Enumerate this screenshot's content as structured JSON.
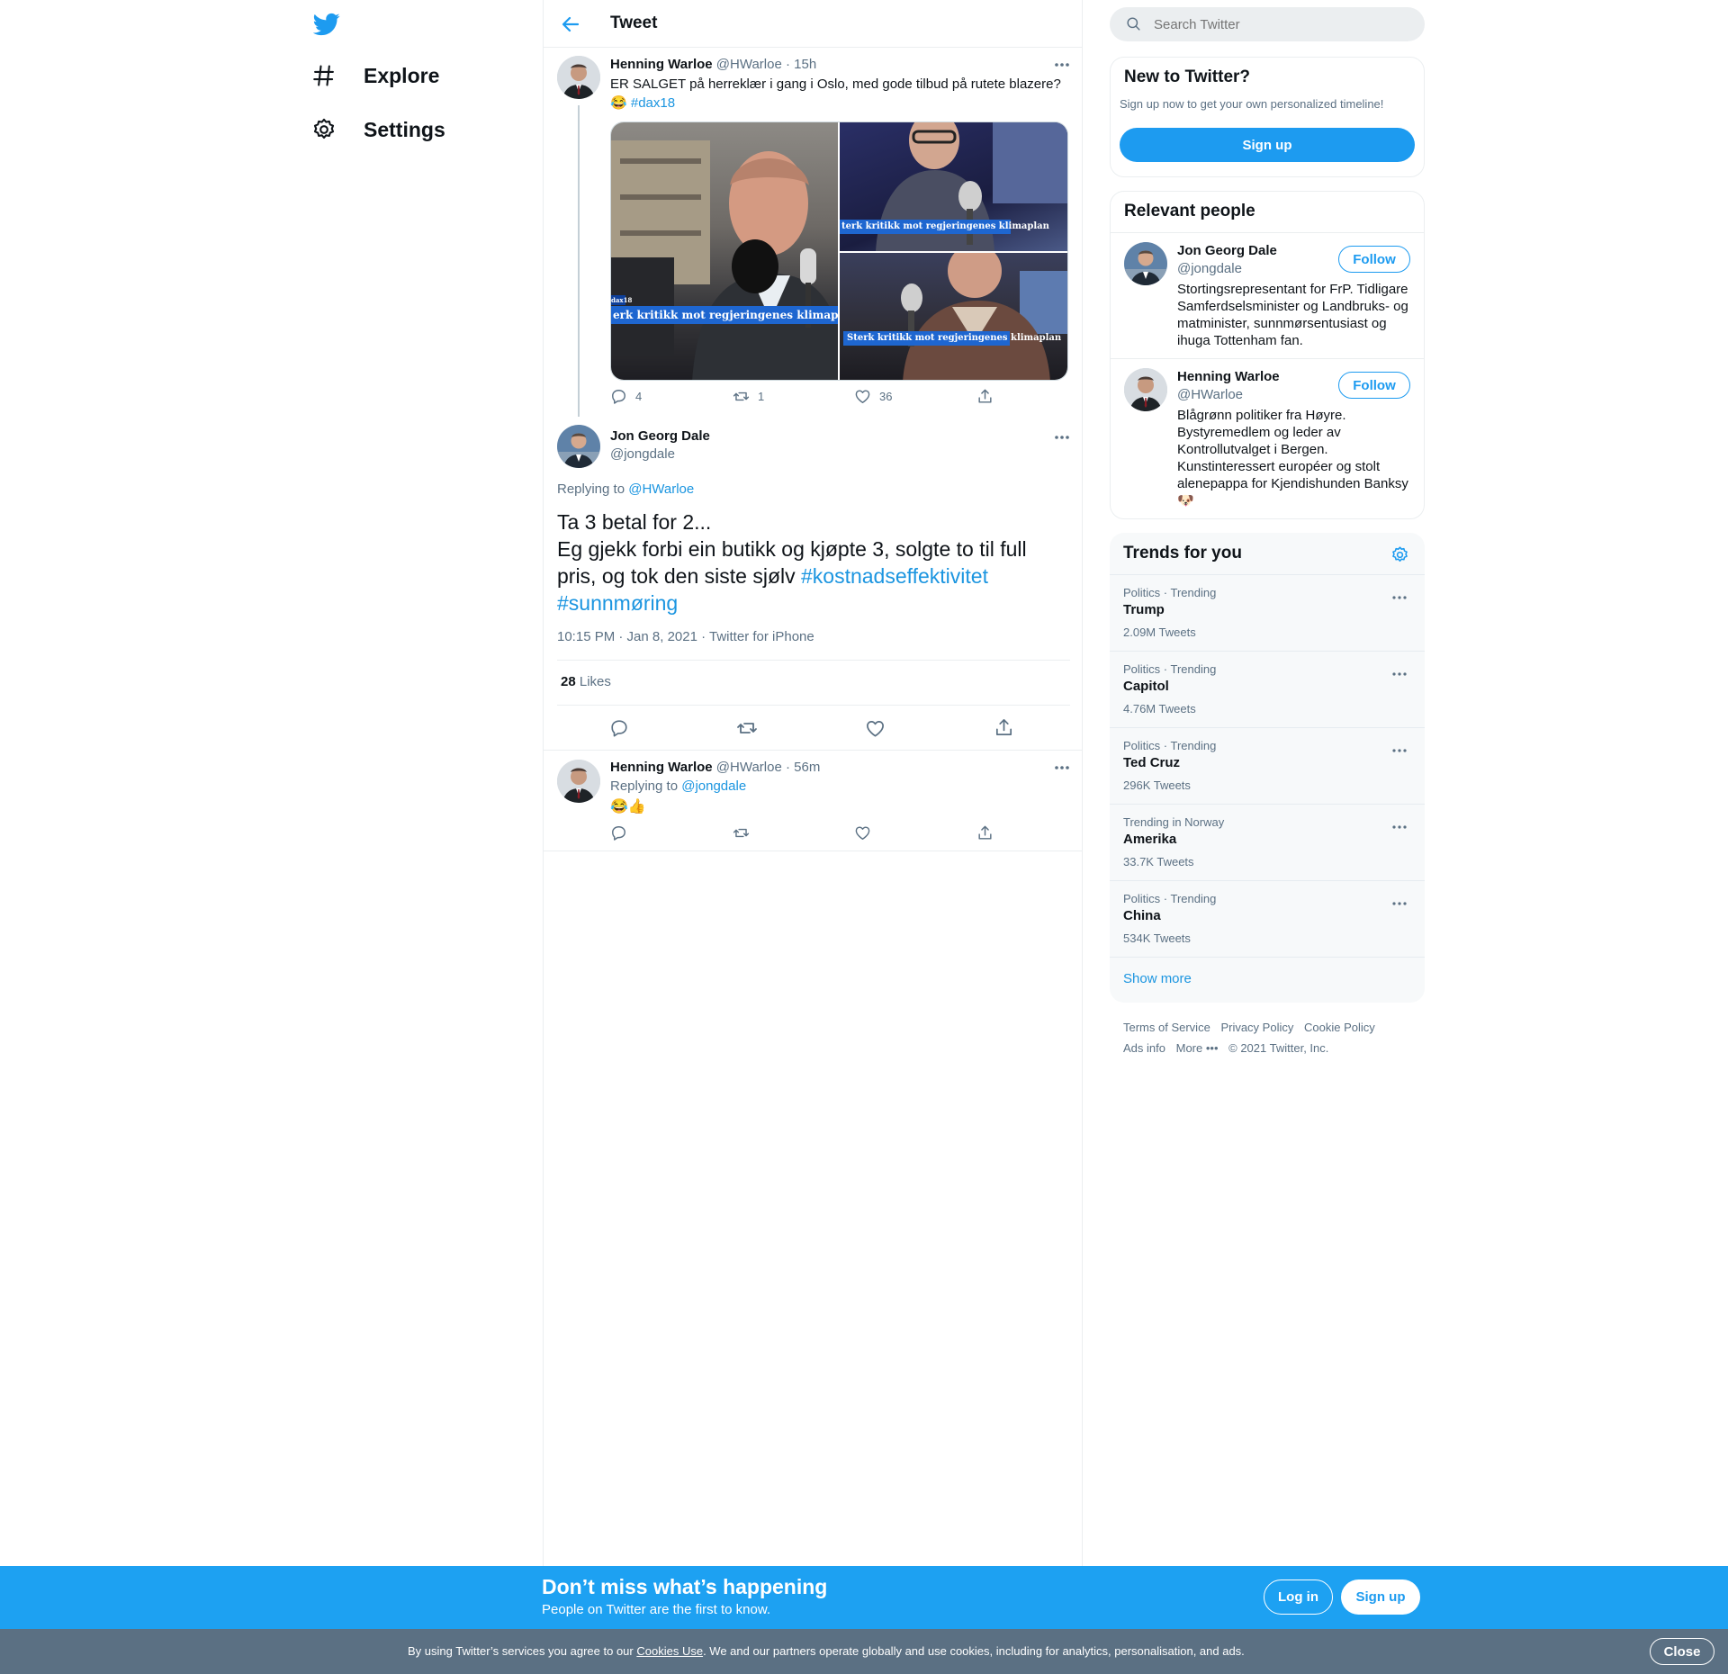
{
  "colors": {
    "brand": "#1d9bf0",
    "banner": "#1da1f2",
    "cookie_bar": "#5b7083",
    "text": "#0f1419",
    "muted": "#5b7083"
  },
  "sidebar": {
    "logo_icon": "twitter-bird-icon",
    "items": [
      {
        "label": "Explore",
        "icon": "hashtag-icon"
      },
      {
        "label": "Settings",
        "icon": "gear-icon"
      }
    ]
  },
  "header": {
    "title": "Tweet",
    "back_icon": "arrow-left-icon"
  },
  "parent_tweet": {
    "name": "Henning Warloe",
    "handle": "@HWarloe",
    "sep": "·",
    "time": "15h",
    "text": "ER SALGET på herreklær i gang i Oslo, med gode tilbud på rutete blazere?",
    "emoji": "😂",
    "hashtag": "#dax18",
    "image_caption": "Sterk kritikk mot regjeringenes klimaplan",
    "image_caption_crop_left": "erk kritikk mot regjeringenes klimaplan",
    "image_caption_crop_right": "terk kritikk mot regjeringenes klimaplan",
    "image_tag": "dax18",
    "replies": "4",
    "retweets": "1",
    "likes": "36"
  },
  "main_tweet": {
    "name": "Jon Georg Dale",
    "handle": "@jongdale",
    "replying_to_label": "Replying to",
    "replying_to": "@HWarloe",
    "line1": "Ta 3 betal for 2...",
    "line2": "Eg gjekk forbi ein butikk og kjøpte 3, solgte to til full pris, og tok den siste sjølv",
    "hashtag1": "#kostnadseffektivitet",
    "hashtag2": "#sunnmøring",
    "meta_time": "10:15 PM · Jan 8, 2021",
    "meta_sep": "·",
    "meta_client": "Twitter for iPhone",
    "likes_count": "28",
    "likes_label": "Likes"
  },
  "reply_tweet": {
    "name": "Henning Warloe",
    "handle": "@HWarloe",
    "sep": "·",
    "time": "56m",
    "replying_to_label": "Replying to",
    "replying_to": "@jongdale",
    "text": "😂👍"
  },
  "search": {
    "placeholder": "Search Twitter",
    "icon": "search-icon"
  },
  "new_to_twitter": {
    "title": "New to Twitter?",
    "subtitle": "Sign up now to get your own personalized timeline!",
    "button": "Sign up"
  },
  "relevant_people": {
    "title": "Relevant people",
    "people": [
      {
        "name": "Jon Georg Dale",
        "handle": "@jongdale",
        "button": "Follow",
        "bio": "Stortingsrepresentant for FrP. Tidligare Samferdselsminister og Landbruks- og matminister, sunnmørsentusiast og ihuga Tottenham fan."
      },
      {
        "name": "Henning Warloe",
        "handle": "@HWarloe",
        "button": "Follow",
        "bio": "Blågrønn politiker fra Høyre. Bystyremedlem og leder av Kontrollutvalget i Bergen. Kunstinteressert européer og stolt alenepappa for Kjendishunden Banksy",
        "bio_emoji": "🐶"
      }
    ]
  },
  "trends": {
    "title": "Trends for you",
    "settings_icon": "gear-icon",
    "items": [
      {
        "category": "Politics · Trending",
        "name": "Trump",
        "count": "2.09M Tweets"
      },
      {
        "category": "Politics · Trending",
        "name": "Capitol",
        "count": "4.76M Tweets"
      },
      {
        "category": "Politics · Trending",
        "name": "Ted Cruz",
        "count": "296K Tweets"
      },
      {
        "category": "Trending in Norway",
        "name": "Amerika",
        "count": "33.7K Tweets"
      },
      {
        "category": "Politics · Trending",
        "name": "China",
        "count": "534K Tweets"
      }
    ],
    "show_more": "Show more"
  },
  "footer": {
    "links": [
      "Terms of Service",
      "Privacy Policy",
      "Cookie Policy",
      "Ads info",
      "More"
    ],
    "copyright": "© 2021 Twitter, Inc."
  },
  "banner": {
    "title": "Don’t miss what’s happening",
    "subtitle": "People on Twitter are the first to know.",
    "login": "Log in",
    "signup": "Sign up"
  },
  "cookie": {
    "pre": "By using Twitter’s services you agree to our",
    "link": "Cookies Use",
    "post": ". We and our partners operate globally and use cookies, including for analytics, personalisation, and ads.",
    "close": "Close"
  }
}
